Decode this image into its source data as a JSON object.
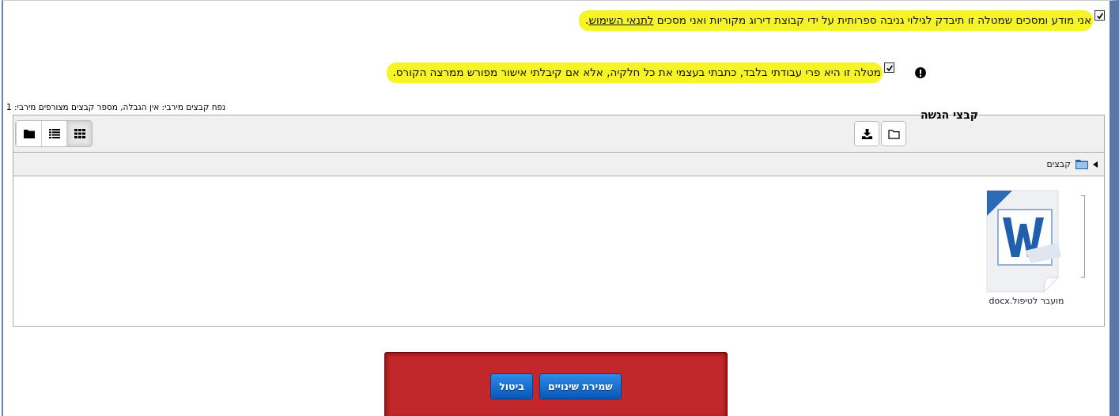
{
  "agreements": [
    {
      "checked": true,
      "highlighted": true,
      "text": "אני מודע ומסכים שמטלה זו תיבדק לגילוי גניבה ספרותית על ידי קבוצת דירוג מקוריות ואני מסכים ",
      "link": "לתנאי השימוש",
      "after": ".",
      "warning": false
    },
    {
      "checked": true,
      "highlighted": true,
      "text": "מטלה זו היא פרי עבודתי בלבד, כתבתי בעצמי את כל חלקיה, אלא אם קיבלתי אישור מפורש ממרצה הקורס.",
      "warning": true
    }
  ],
  "file_manager": {
    "label": "קבצי הגשה",
    "limits": "נפח קבצים מירבי: אין הגבלה, מספר קבצים מצורפים מירבי: 1",
    "view_buttons": [
      {
        "kind": "icons",
        "selected": true
      },
      {
        "kind": "list",
        "selected": false
      },
      {
        "kind": "tree",
        "selected": false
      }
    ],
    "path": "קבצים",
    "files": [
      {
        "name": "מועבר לטיפול.docx",
        "kind": "word"
      }
    ]
  },
  "buttons": [
    {
      "label": "שמירת שינויים"
    },
    {
      "label": "ביטול"
    }
  ]
}
